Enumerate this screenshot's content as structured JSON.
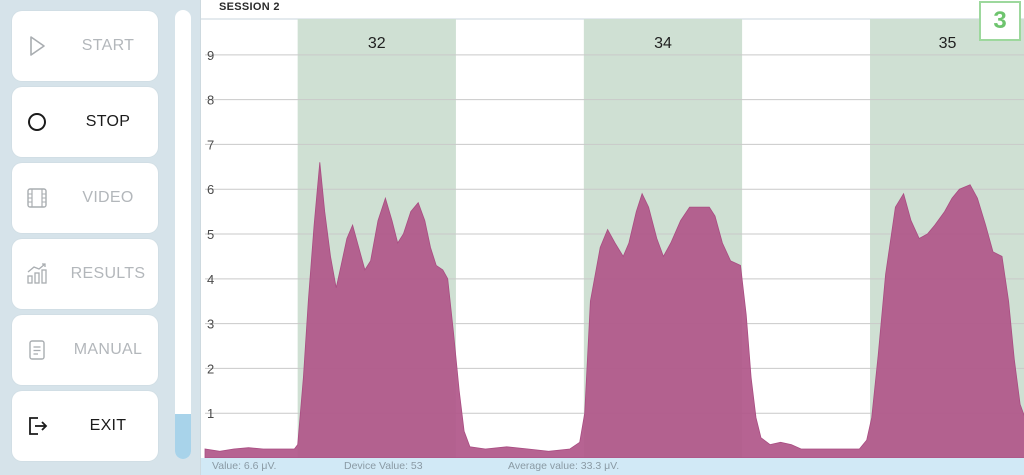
{
  "sidebar": {
    "buttons": [
      {
        "label": "START",
        "icon": "play-icon",
        "enabled": false
      },
      {
        "label": "STOP",
        "icon": "stop-circle-icon",
        "enabled": true
      },
      {
        "label": "VIDEO",
        "icon": "film-icon",
        "enabled": false
      },
      {
        "label": "RESULTS",
        "icon": "bar-chart-icon",
        "enabled": false
      },
      {
        "label": "MANUAL",
        "icon": "document-icon",
        "enabled": false
      },
      {
        "label": "EXIT",
        "icon": "exit-icon",
        "enabled": true
      }
    ],
    "session_progress": 0.1
  },
  "session": {
    "title": "SESSION 2",
    "count": "3"
  },
  "status": {
    "value": "Value: 6.6 μV.",
    "device_value": "Device Value: 53",
    "average_value": "Average value: 33.3 μV."
  },
  "colors": {
    "band": "#cfe0d3",
    "area": "#b0578a",
    "accent": "#6ec46e",
    "progress": "#a8d3ea"
  },
  "chart_data": {
    "type": "area",
    "y_ticks": [
      "1",
      "2",
      "3",
      "4",
      "5",
      "6",
      "7",
      "8",
      "9"
    ],
    "ylim": [
      0,
      9.8
    ],
    "grid": true,
    "x_range": [
      0,
      100
    ],
    "bands": [
      {
        "start": 11.3,
        "end": 30.6,
        "label": "32"
      },
      {
        "start": 46.2,
        "end": 65.5,
        "label": "34"
      },
      {
        "start": 81.1,
        "end": 100,
        "label": "35"
      }
    ],
    "series": [
      {
        "points": [
          [
            0,
            0.2
          ],
          [
            1.8,
            0.15
          ],
          [
            3.5,
            0.2
          ],
          [
            5.3,
            0.23
          ],
          [
            7.1,
            0.2
          ],
          [
            9.1,
            0.2
          ],
          [
            10.9,
            0.2
          ],
          [
            11.3,
            0.3
          ],
          [
            12,
            1.8
          ],
          [
            12.6,
            3.5
          ],
          [
            13.3,
            5.2
          ],
          [
            14,
            6.6
          ],
          [
            14.6,
            5.5
          ],
          [
            15.3,
            4.5
          ],
          [
            16,
            3.8
          ],
          [
            16.6,
            4.3
          ],
          [
            17.3,
            4.9
          ],
          [
            18,
            5.2
          ],
          [
            18.6,
            4.8
          ],
          [
            19.5,
            4.2
          ],
          [
            20.2,
            4.4
          ],
          [
            21.1,
            5.3
          ],
          [
            22,
            5.8
          ],
          [
            22.8,
            5.3
          ],
          [
            23.5,
            4.8
          ],
          [
            24.2,
            5.0
          ],
          [
            25.1,
            5.5
          ],
          [
            26,
            5.7
          ],
          [
            26.8,
            5.3
          ],
          [
            27.5,
            4.7
          ],
          [
            28.2,
            4.3
          ],
          [
            29,
            4.2
          ],
          [
            29.6,
            4.0
          ],
          [
            30.3,
            2.8
          ],
          [
            31,
            1.5
          ],
          [
            31.6,
            0.6
          ],
          [
            32.3,
            0.25
          ],
          [
            34.2,
            0.2
          ],
          [
            36.8,
            0.25
          ],
          [
            39.4,
            0.2
          ],
          [
            41.9,
            0.15
          ],
          [
            44.5,
            0.2
          ],
          [
            45.7,
            0.35
          ],
          [
            46.3,
            1.0
          ],
          [
            47,
            3.5
          ],
          [
            48.2,
            4.7
          ],
          [
            49.1,
            5.1
          ],
          [
            50,
            4.8
          ],
          [
            51,
            4.5
          ],
          [
            51.7,
            4.8
          ],
          [
            52.6,
            5.5
          ],
          [
            53.3,
            5.9
          ],
          [
            54.1,
            5.6
          ],
          [
            55.1,
            4.9
          ],
          [
            55.9,
            4.5
          ],
          [
            56.8,
            4.8
          ],
          [
            58,
            5.3
          ],
          [
            59.1,
            5.6
          ],
          [
            60.3,
            5.6
          ],
          [
            61.5,
            5.6
          ],
          [
            62.2,
            5.4
          ],
          [
            63.1,
            4.8
          ],
          [
            64.1,
            4.4
          ],
          [
            65.3,
            4.3
          ],
          [
            66,
            3.2
          ],
          [
            66.6,
            1.8
          ],
          [
            67.2,
            0.9
          ],
          [
            67.8,
            0.45
          ],
          [
            68.9,
            0.3
          ],
          [
            70.2,
            0.35
          ],
          [
            71.5,
            0.3
          ],
          [
            72.7,
            0.2
          ],
          [
            74.3,
            0.2
          ],
          [
            77.5,
            0.2
          ],
          [
            79.8,
            0.2
          ],
          [
            80.7,
            0.4
          ],
          [
            81.3,
            0.9
          ],
          [
            82.1,
            2.3
          ],
          [
            83,
            4.1
          ],
          [
            84.2,
            5.6
          ],
          [
            85.2,
            5.9
          ],
          [
            86.1,
            5.3
          ],
          [
            87.1,
            4.9
          ],
          [
            88.1,
            5.0
          ],
          [
            89,
            5.2
          ],
          [
            90.2,
            5.5
          ],
          [
            91.1,
            5.8
          ],
          [
            92,
            6.0
          ],
          [
            93.3,
            6.1
          ],
          [
            94.2,
            5.8
          ],
          [
            95.2,
            5.2
          ],
          [
            96.1,
            4.6
          ],
          [
            97.2,
            4.5
          ],
          [
            98,
            3.5
          ],
          [
            98.7,
            2.2
          ],
          [
            99.4,
            1.2
          ],
          [
            100,
            0.9
          ]
        ]
      }
    ]
  }
}
